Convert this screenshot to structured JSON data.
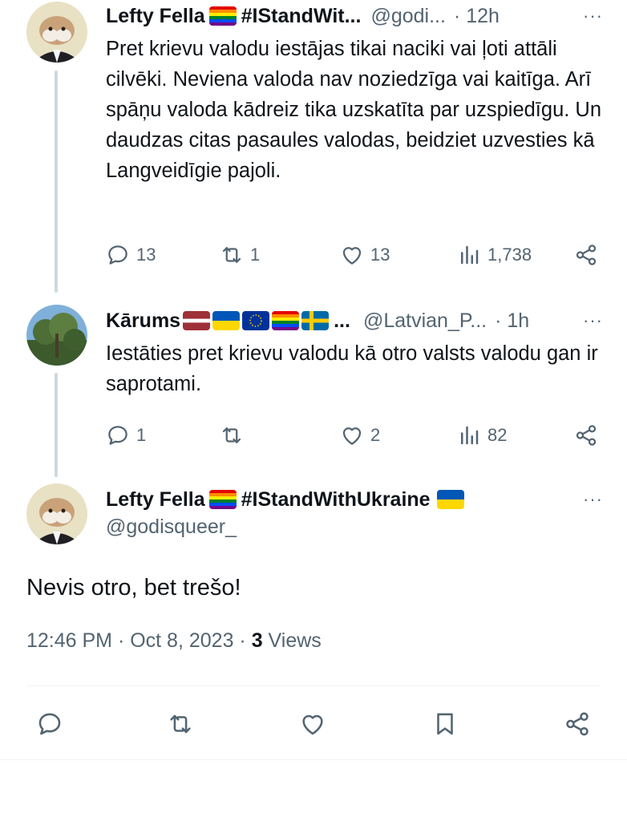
{
  "tweets": [
    {
      "name": "Lefty Fella",
      "hashtag": "#IStandWit...",
      "handle": "@godi...",
      "time": "· 12h",
      "text": "Pret krievu valodu iestājas tikai naciki vai ļoti attāli cilvēki. Neviena valoda nav noziedzīga vai kaitīga. Arī spāņu valoda kādreiz tika uzskatīta par uzspiedīgu. Un daudzas citas pasaules valodas, beidziet uzvesties kā Langveidīgie pajoli.",
      "replies": "13",
      "retweets": "1",
      "likes": "13",
      "views": "1,738"
    },
    {
      "name": "Kārums",
      "hashtag": "...",
      "handle": "@Latvian_P...",
      "time": "· 1h",
      "text": "Iestāties pret krievu valodu kā otro valsts valodu gan ir saprotami.",
      "replies": "1",
      "retweets": "",
      "likes": "2",
      "views": "82"
    }
  ],
  "main_tweet": {
    "name": "Lefty Fella",
    "hashtag": "#IStandWithUkraine",
    "handle": "@godisqueer_",
    "text": "Nevis otro, bet trešo!",
    "timestamp": "12:46 PM · Oct 8, 2023 · ",
    "views_count": "3",
    "views_label": " Views"
  },
  "more_icon": "···",
  "colors": {
    "text": "#0f1419",
    "secondary": "#536471",
    "divider": "#eff3f4",
    "thread_line": "#cfd9de"
  },
  "icons": [
    "reply-icon",
    "retweet-icon",
    "like-icon",
    "views-icon",
    "share-icon",
    "bookmark-icon",
    "more-icon"
  ]
}
